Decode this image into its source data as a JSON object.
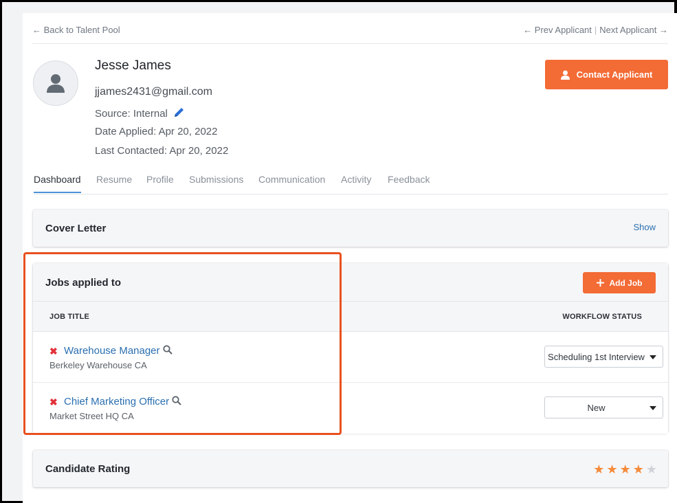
{
  "nav": {
    "back": "← Back to Talent Pool",
    "prev": "← Prev Applicant",
    "separator": "|",
    "next": "Next Applicant →"
  },
  "applicant": {
    "name": "Jesse James",
    "email": "jjames2431@gmail.com",
    "source": "Source: Internal",
    "date_applied": "Date Applied: Apr 20, 2022",
    "last_contacted": "Last Contacted: Apr 20, 2022"
  },
  "contact_button": "Contact Applicant",
  "tabs": [
    {
      "label": "Dashboard",
      "active": true
    },
    {
      "label": "Resume"
    },
    {
      "label": "Profile"
    },
    {
      "label": "Submissions"
    },
    {
      "label": "Communication"
    },
    {
      "label": "Activity"
    },
    {
      "label": "Feedback"
    }
  ],
  "cover_letter": {
    "title": "Cover Letter",
    "action": "Show"
  },
  "jobs": {
    "title": "Jobs applied to",
    "add_button": "Add Job",
    "columns": {
      "job_title": "JOB TITLE",
      "workflow_status": "WORKFLOW STATUS"
    },
    "rows": [
      {
        "title": "Warehouse Manager",
        "location": "Berkeley Warehouse CA",
        "status": "Scheduling 1st Interview"
      },
      {
        "title": "Chief Marketing Officer",
        "location": "Market Street HQ CA",
        "status": "New"
      }
    ]
  },
  "rating": {
    "title": "Candidate Rating",
    "value": 4,
    "max": 5
  },
  "colors": {
    "accent": "#f36b35",
    "link": "#2a6fb0",
    "remove": "#e3323a",
    "star_filled": "#f58a3a",
    "star_empty": "#cfd3d8",
    "highlight": "#e8501f"
  },
  "icons": [
    "user-icon",
    "pencil-icon",
    "plus-icon",
    "remove-x-icon",
    "magnifier-icon",
    "star-icon",
    "caret-down-icon"
  ]
}
